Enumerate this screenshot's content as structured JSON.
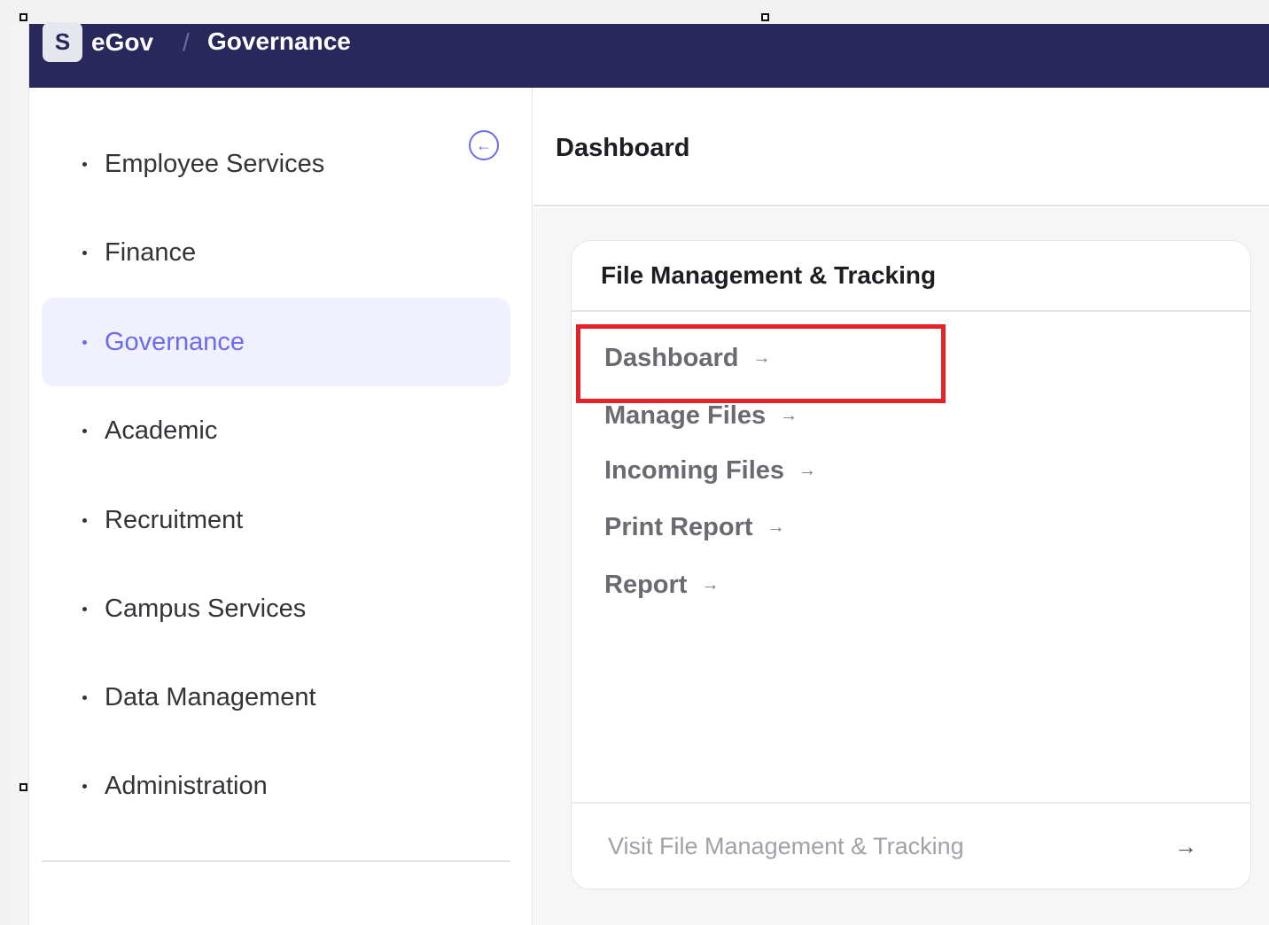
{
  "header": {
    "logo_letter": "S",
    "app_name": "eGov",
    "separator": "/",
    "current_section": "Governance",
    "background_color": "#28285c"
  },
  "sidebar": {
    "collapse_icon": "arrow-left-circle-icon",
    "items": [
      {
        "label": "Employee Services",
        "active": false
      },
      {
        "label": "Finance",
        "active": false
      },
      {
        "label": "Governance",
        "active": true
      },
      {
        "label": "Academic",
        "active": false
      },
      {
        "label": "Recruitment",
        "active": false
      },
      {
        "label": "Campus Services",
        "active": false
      },
      {
        "label": "Data Management",
        "active": false
      },
      {
        "label": "Administration",
        "active": false
      }
    ],
    "active_color": "#6b6bee"
  },
  "main": {
    "page_title": "Dashboard",
    "card": {
      "title": "File Management & Tracking",
      "links": [
        {
          "label": "Dashboard",
          "arrow": "→"
        },
        {
          "label": "Manage Files",
          "arrow": "→"
        },
        {
          "label": "Incoming Files",
          "arrow": "→"
        },
        {
          "label": "Print Report",
          "arrow": "→"
        },
        {
          "label": "Report",
          "arrow": "→"
        }
      ],
      "footer_label": "Visit File Management & Tracking",
      "footer_arrow": "→"
    }
  },
  "annotation": {
    "highlight_color": "#e52228",
    "highlighted_item": "Dashboard"
  }
}
